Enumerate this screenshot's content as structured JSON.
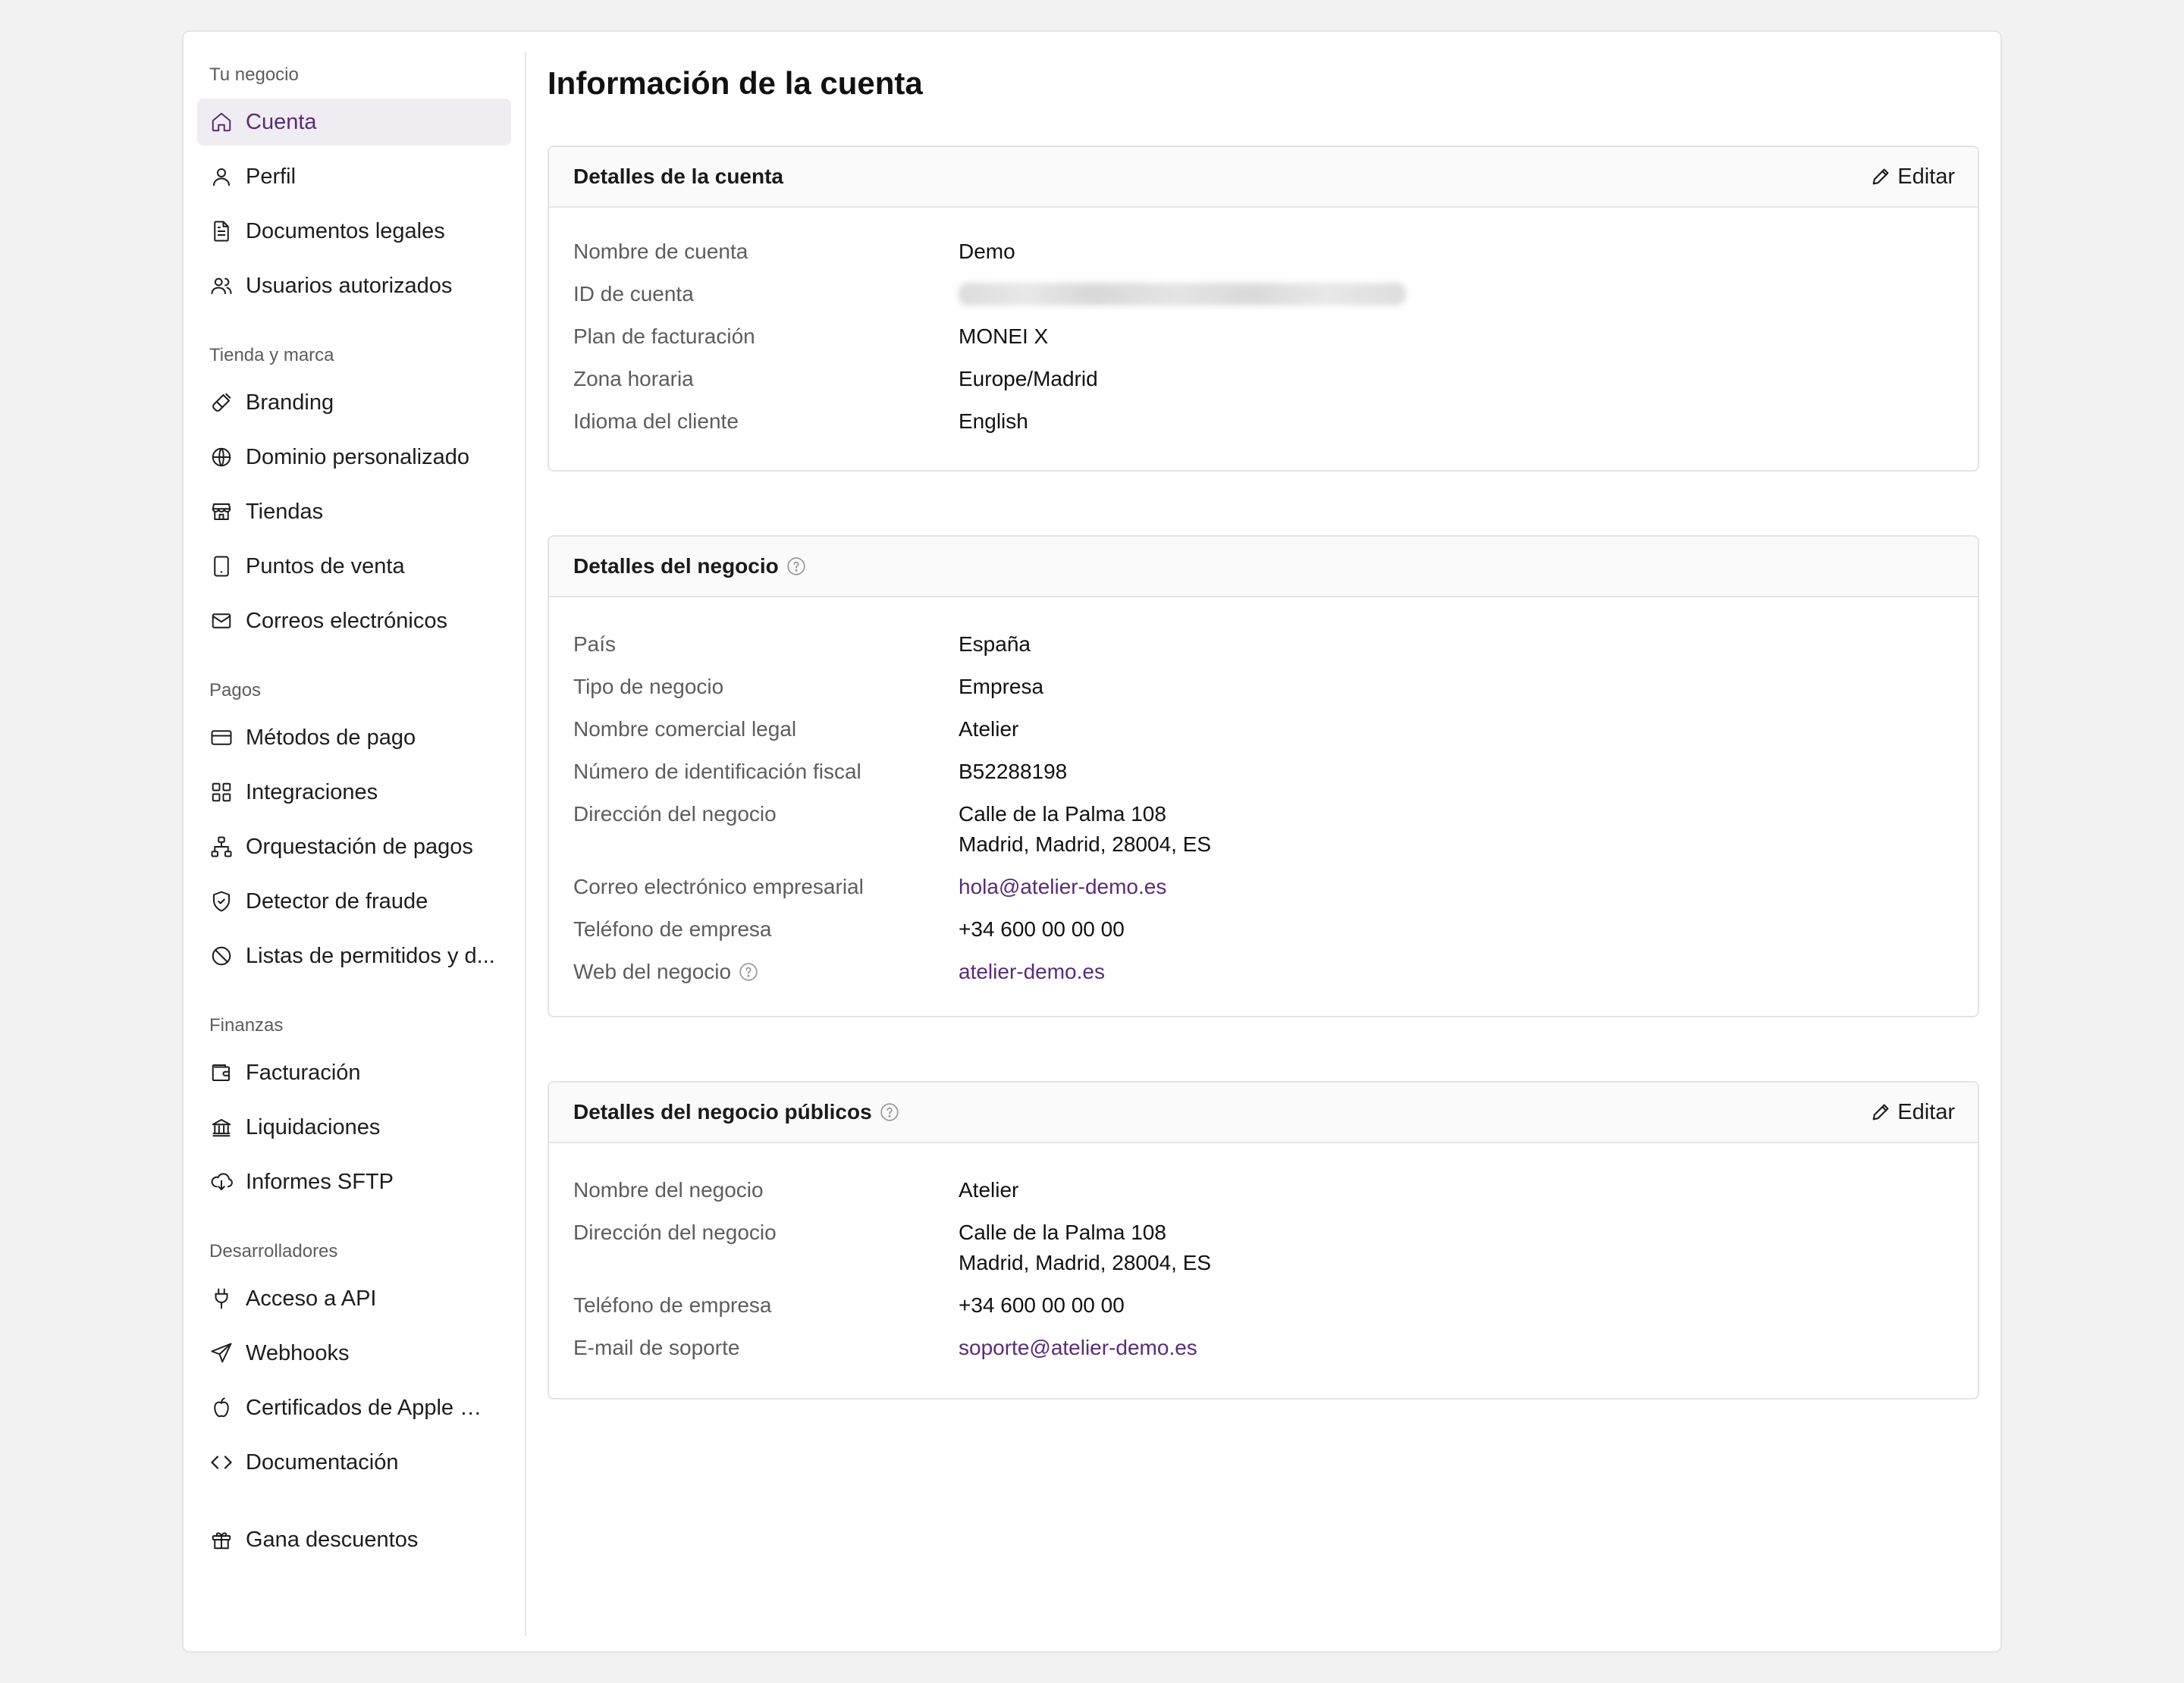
{
  "sidebar": {
    "groups": [
      {
        "title": "Tu negocio",
        "items": [
          {
            "label": "Cuenta",
            "icon": "home-icon",
            "active": true
          },
          {
            "label": "Perfil",
            "icon": "user-icon"
          },
          {
            "label": "Documentos legales",
            "icon": "document-icon"
          },
          {
            "label": "Usuarios autorizados",
            "icon": "users-icon"
          }
        ]
      },
      {
        "title": "Tienda y marca",
        "items": [
          {
            "label": "Branding",
            "icon": "brush-icon"
          },
          {
            "label": "Dominio personalizado",
            "icon": "globe-icon"
          },
          {
            "label": "Tiendas",
            "icon": "store-icon"
          },
          {
            "label": "Puntos de venta",
            "icon": "tablet-icon"
          },
          {
            "label": "Correos electrónicos",
            "icon": "mail-icon"
          }
        ]
      },
      {
        "title": "Pagos",
        "items": [
          {
            "label": "Métodos de pago",
            "icon": "credit-card-icon"
          },
          {
            "label": "Integraciones",
            "icon": "grid-icon"
          },
          {
            "label": "Orquestación de pagos",
            "icon": "network-icon"
          },
          {
            "label": "Detector de fraude",
            "icon": "shield-icon"
          },
          {
            "label": "Listas de permitidos y d...",
            "icon": "ban-icon"
          }
        ]
      },
      {
        "title": "Finanzas",
        "items": [
          {
            "label": "Facturación",
            "icon": "wallet-icon"
          },
          {
            "label": "Liquidaciones",
            "icon": "bank-icon"
          },
          {
            "label": "Informes SFTP",
            "icon": "cloud-download-icon"
          }
        ]
      },
      {
        "title": "Desarrolladores",
        "items": [
          {
            "label": "Acceso a API",
            "icon": "plug-icon"
          },
          {
            "label": "Webhooks",
            "icon": "send-icon"
          },
          {
            "label": "Certificados de Apple Pay",
            "icon": "apple-icon"
          },
          {
            "label": "Documentación",
            "icon": "code-icon"
          }
        ]
      },
      {
        "title": "",
        "items": [
          {
            "label": "Gana descuentos",
            "icon": "gift-icon"
          }
        ]
      }
    ]
  },
  "page": {
    "title": "Información de la cuenta"
  },
  "account_card": {
    "title": "Detalles de la cuenta",
    "edit_label": "Editar",
    "rows": [
      {
        "label": "Nombre de cuenta",
        "value": "Demo"
      },
      {
        "label": "ID de cuenta",
        "value": ""
      },
      {
        "label": "Plan de facturación",
        "value": "MONEI X"
      },
      {
        "label": "Zona horaria",
        "value": "Europe/Madrid"
      },
      {
        "label": "Idioma del cliente",
        "value": "English"
      }
    ]
  },
  "business_card": {
    "title": "Detalles del negocio",
    "rows": [
      {
        "label": "País",
        "value": "España"
      },
      {
        "label": "Tipo de negocio",
        "value": "Empresa"
      },
      {
        "label": "Nombre comercial legal",
        "value": "Atelier"
      },
      {
        "label": "Número de identificación fiscal",
        "value": "B52288198"
      },
      {
        "label": "Dirección del negocio",
        "value_line1": "Calle de la Palma 108",
        "value_line2": "Madrid, Madrid, 28004, ES"
      },
      {
        "label": "Correo electrónico empresarial",
        "value": "hola@atelier-demo.es"
      },
      {
        "label": "Teléfono de empresa",
        "value": "+34 600 00 00 00"
      },
      {
        "label": "Web del negocio",
        "value": "atelier-demo.es"
      }
    ]
  },
  "public_card": {
    "title": "Detalles del negocio públicos",
    "edit_label": "Editar",
    "rows": [
      {
        "label": "Nombre del negocio",
        "value": "Atelier"
      },
      {
        "label": "Dirección del negocio",
        "value_line1": "Calle de la Palma 108",
        "value_line2": "Madrid, Madrid, 28004, ES"
      },
      {
        "label": "Teléfono de empresa",
        "value": "+34 600 00 00 00"
      },
      {
        "label": "E-mail de soporte",
        "value": "soporte@atelier-demo.es"
      }
    ]
  },
  "colors": {
    "accent": "#5b2b78",
    "active_bg": "#efedf2",
    "page_bg": "#f2f2f2"
  }
}
